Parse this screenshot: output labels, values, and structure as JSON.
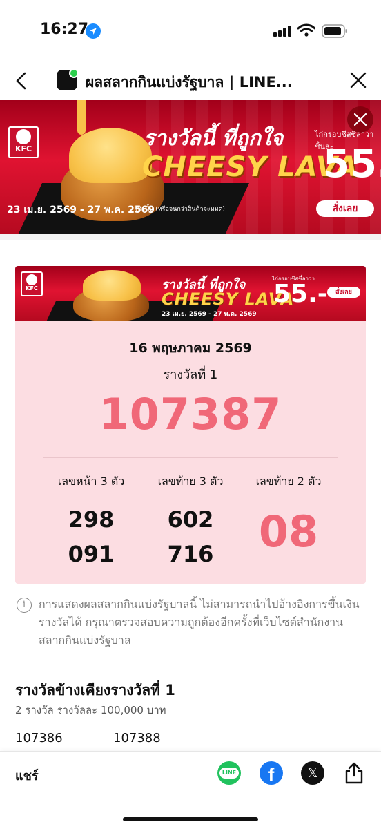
{
  "status_bar": {
    "time": "16:27"
  },
  "nav": {
    "title": "ผลสลากกินแบ่งรัฐบาล | LINE..."
  },
  "ad": {
    "brand_logo_text": "KFC",
    "headline": "รางวัลนี้ ที่ถูกใจ",
    "product": "CHEESY LAVA",
    "price_label": "ไก่กรอบชีสซี่ลาวา",
    "price_prefix": "ชิ้นละ",
    "price": "55.-",
    "dates": "23 เม.ย. 2569 - 27 พ.ค. 2569",
    "note": "เท่านั้น (หรือจนกว่าสินค้าจะหมด)",
    "cta": "สั่งเลย"
  },
  "lottery": {
    "draw_date": "16 พฤษภาคม 2569",
    "first_prize_label": "รางวัลที่ 1",
    "first_prize_number": "107387",
    "front3_label": "เลขหน้า 3 ตัว",
    "front3_numbers": [
      "298",
      "091"
    ],
    "back3_label": "เลขท้าย 3 ตัว",
    "back3_numbers": [
      "602",
      "716"
    ],
    "back2_label": "เลขท้าย 2 ตัว",
    "back2_number": "08",
    "accent_color": "#f06878",
    "card_bg": "#fcdde2"
  },
  "disclaimer": "การแสดงผลสลากกินแบ่งรัฐบาลนี้ ไม่สามารถนำไปอ้างอิงการขึ้นเงินรางวัลได้ กรุณาตรวจสอบความถูกต้องอีกครั้งที่เว็บไซต์สำนักงานสลากกินแบ่งรัฐบาล",
  "adjacent": {
    "title": "รางวัลข้างเคียงรางวัลที่ 1",
    "subtitle": "2 รางวัล รางวัลละ 100,000 บาท",
    "numbers": [
      "107386",
      "107388"
    ]
  },
  "share": {
    "label": "แชร์",
    "line_icon_text": "LINE",
    "facebook_glyph": "f",
    "x_glyph": "𝕏",
    "icons": [
      "line-icon",
      "facebook-icon",
      "x-icon",
      "share-upload-icon"
    ]
  }
}
